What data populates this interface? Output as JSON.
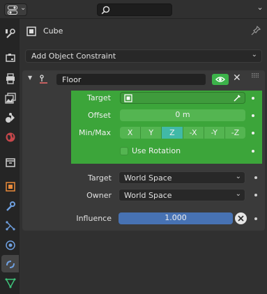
{
  "header": {
    "editor_icon": "properties-editor-icon",
    "search_placeholder": ""
  },
  "tabs": [
    {
      "name": "tool-tab",
      "icon": "wrench-screwdriver-icon",
      "active": false
    },
    {
      "name": "render-tab",
      "icon": "camera-back-icon",
      "active": false
    },
    {
      "name": "output-tab",
      "icon": "printer-icon",
      "active": false
    },
    {
      "name": "view-layer-tab",
      "icon": "image-stack-icon",
      "active": false
    },
    {
      "name": "scene-tab",
      "icon": "scene-icon",
      "active": false
    },
    {
      "name": "world-tab",
      "icon": "world-icon",
      "active": false
    },
    {
      "name": "collection-tab",
      "icon": "collection-box-icon",
      "active": false
    },
    {
      "name": "object-tab",
      "icon": "object-square-icon",
      "active": false
    },
    {
      "name": "modifier-tab",
      "icon": "wrench-icon",
      "active": false
    },
    {
      "name": "particles-tab",
      "icon": "particles-icon",
      "active": false
    },
    {
      "name": "physics-tab",
      "icon": "physics-orbit-icon",
      "active": false
    },
    {
      "name": "constraints-tab",
      "icon": "object-constraint-icon",
      "active": true
    },
    {
      "name": "data-tab",
      "icon": "mesh-triangle-icon",
      "active": false
    }
  ],
  "object": {
    "name": "Cube"
  },
  "add_constraint": {
    "label": "Add Object Constraint"
  },
  "constraint": {
    "name": "Floor",
    "target_label": "Target",
    "target_value": "",
    "offset_label": "Offset",
    "offset_value": "0 m",
    "minmax_label": "Min/Max",
    "axes": [
      {
        "label": "X",
        "selected": false
      },
      {
        "label": "Y",
        "selected": false
      },
      {
        "label": "Z",
        "selected": true
      },
      {
        "label": "-X",
        "selected": false
      },
      {
        "label": "-Y",
        "selected": false
      },
      {
        "label": "-Z",
        "selected": false
      }
    ],
    "use_rotation_label": "Use Rotation",
    "use_rotation": false,
    "target_space_label": "Target",
    "target_space_value": "World Space",
    "owner_space_label": "Owner",
    "owner_space_value": "World Space",
    "influence_label": "Influence",
    "influence_value": "1.000"
  },
  "colors": {
    "accent_green": "#3ca53a",
    "axis_selected": "#41b9a7",
    "influence_blue": "#4772b3",
    "eye_green": "#3cb34a"
  }
}
